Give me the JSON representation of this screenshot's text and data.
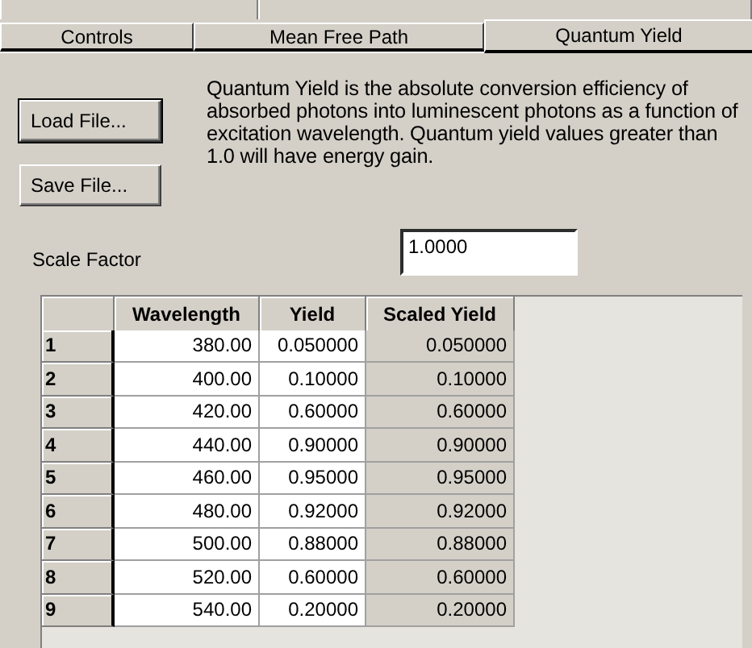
{
  "tabs": [
    {
      "label": "Controls",
      "selected": false
    },
    {
      "label": "Mean Free Path",
      "selected": false
    },
    {
      "label": "Quantum Yield",
      "selected": true
    }
  ],
  "buttons": [
    {
      "label": "Load File..."
    },
    {
      "label": "Save File..."
    }
  ],
  "description": "Quantum Yield is the absolute conversion efficiency of absorbed photons into luminescent photons as a function of excitation wavelength. Quantum yield values greater than 1.0 will have energy gain.",
  "scale_factor": {
    "label": "Scale Factor",
    "value": "1.0000"
  },
  "table": {
    "columns": [
      {
        "label": "Wavelength",
        "read_only": false
      },
      {
        "label": "Yield",
        "read_only": false
      },
      {
        "label": "Scaled Yield",
        "read_only": true
      }
    ],
    "rows": [
      {
        "header": "1",
        "cells": [
          "380.00",
          "0.050000",
          "0.050000"
        ]
      },
      {
        "header": "2",
        "cells": [
          "400.00",
          "0.10000",
          "0.10000"
        ]
      },
      {
        "header": "3",
        "cells": [
          "420.00",
          "0.60000",
          "0.60000"
        ]
      },
      {
        "header": "4",
        "cells": [
          "440.00",
          "0.90000",
          "0.90000"
        ]
      },
      {
        "header": "5",
        "cells": [
          "460.00",
          "0.95000",
          "0.95000"
        ]
      },
      {
        "header": "6",
        "cells": [
          "480.00",
          "0.92000",
          "0.92000"
        ]
      },
      {
        "header": "7",
        "cells": [
          "500.00",
          "0.88000",
          "0.88000"
        ]
      },
      {
        "header": "8",
        "cells": [
          "520.00",
          "0.60000",
          "0.60000"
        ]
      },
      {
        "header": "9",
        "cells": [
          "540.00",
          "0.20000",
          "0.20000"
        ]
      }
    ]
  }
}
